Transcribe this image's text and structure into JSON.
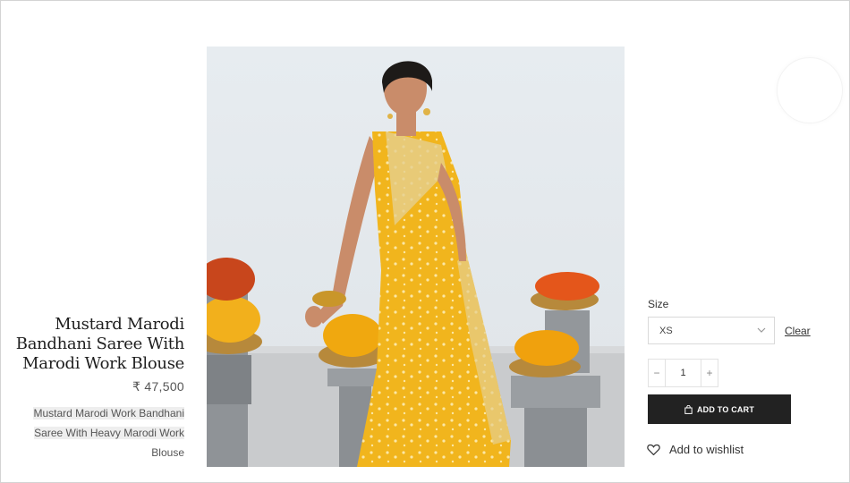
{
  "product": {
    "title_lines": [
      "Mustard Marodi",
      "Bandhani Saree With",
      "Marodi Work Blouse"
    ],
    "price": "₹ 47,500",
    "description_lines": [
      "Mustard Marodi Work Bandhani",
      "Saree With Heavy Marodi Work",
      "Blouse"
    ]
  },
  "options": {
    "size_label": "Size",
    "size_selected": "XS",
    "clear_label": "Clear"
  },
  "quantity": {
    "minus": "−",
    "value": "1",
    "plus": "+"
  },
  "actions": {
    "add_to_cart": "ADD TO CART",
    "add_to_cart_icon": "shopping-bag-icon",
    "wishlist": "Add to wishlist",
    "wishlist_icon": "heart-icon"
  },
  "colors": {
    "cart_button_bg": "#222222",
    "saree": "#f2b81f"
  }
}
